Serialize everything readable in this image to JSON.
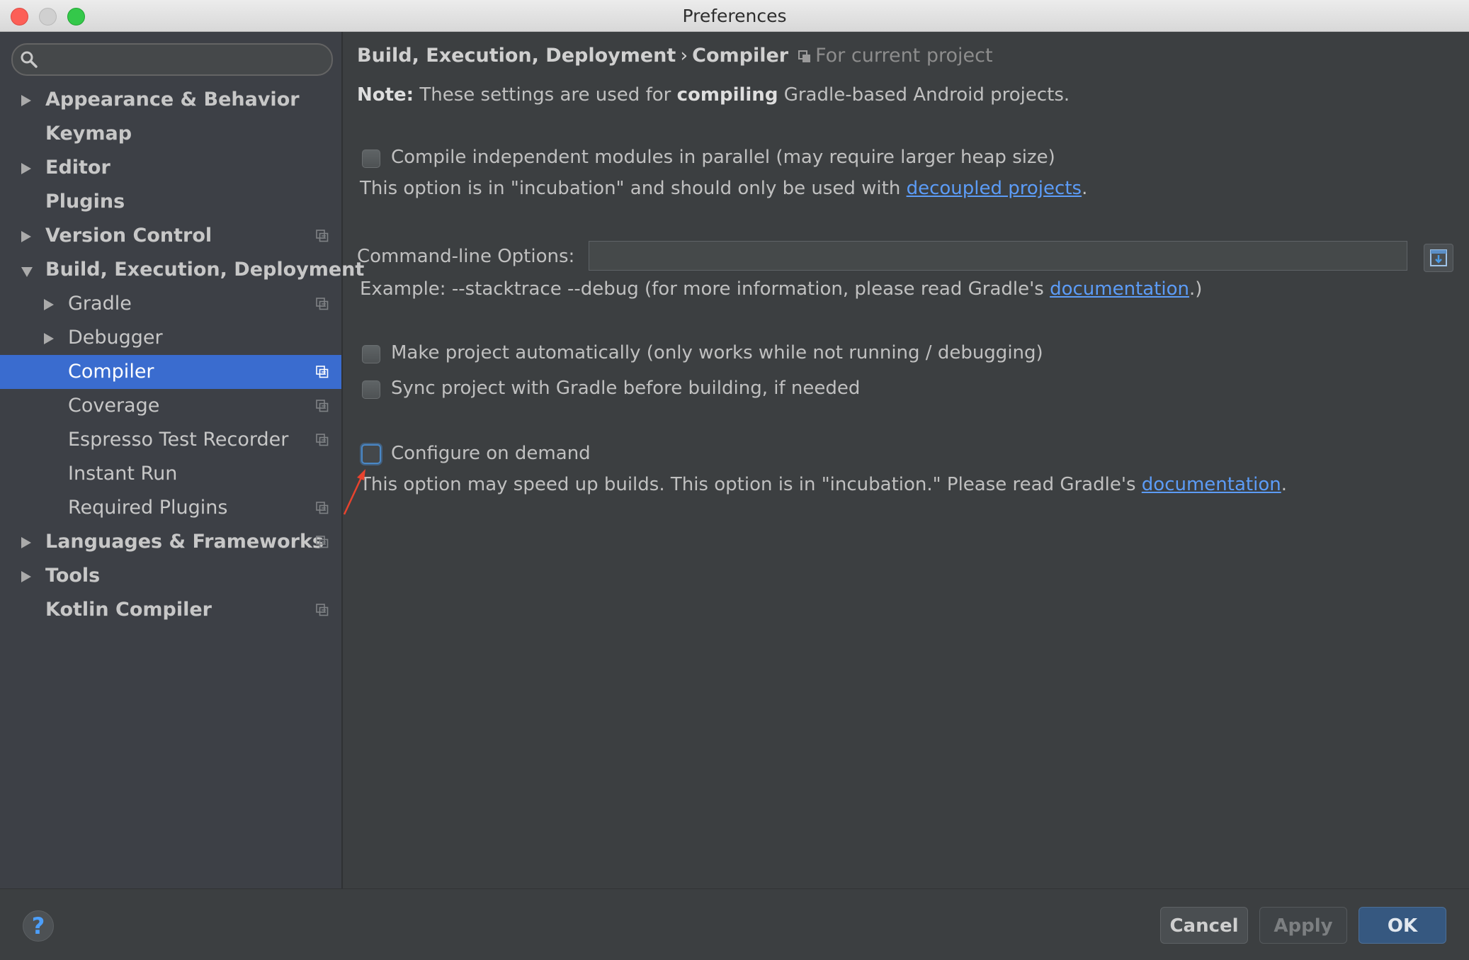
{
  "window": {
    "title": "Preferences"
  },
  "search": {
    "value": "",
    "placeholder": ""
  },
  "sidebar": {
    "items": [
      {
        "label": "Appearance & Behavior",
        "level": 0,
        "arrow": "right",
        "bold": true,
        "project_icon": false,
        "selected": false
      },
      {
        "label": "Keymap",
        "level": 0,
        "arrow": "none",
        "bold": true,
        "project_icon": false,
        "selected": false
      },
      {
        "label": "Editor",
        "level": 0,
        "arrow": "right",
        "bold": true,
        "project_icon": false,
        "selected": false
      },
      {
        "label": "Plugins",
        "level": 0,
        "arrow": "none",
        "bold": true,
        "project_icon": false,
        "selected": false
      },
      {
        "label": "Version Control",
        "level": 0,
        "arrow": "right",
        "bold": true,
        "project_icon": true,
        "selected": false
      },
      {
        "label": "Build, Execution, Deployment",
        "level": 0,
        "arrow": "down",
        "bold": true,
        "project_icon": false,
        "selected": false
      },
      {
        "label": "Gradle",
        "level": 1,
        "arrow": "right",
        "bold": false,
        "project_icon": true,
        "selected": false
      },
      {
        "label": "Debugger",
        "level": 1,
        "arrow": "right",
        "bold": false,
        "project_icon": false,
        "selected": false
      },
      {
        "label": "Compiler",
        "level": 1,
        "arrow": "none",
        "bold": false,
        "project_icon": true,
        "selected": true
      },
      {
        "label": "Coverage",
        "level": 1,
        "arrow": "none",
        "bold": false,
        "project_icon": true,
        "selected": false
      },
      {
        "label": "Espresso Test Recorder",
        "level": 1,
        "arrow": "none",
        "bold": false,
        "project_icon": true,
        "selected": false
      },
      {
        "label": "Instant Run",
        "level": 1,
        "arrow": "none",
        "bold": false,
        "project_icon": false,
        "selected": false
      },
      {
        "label": "Required Plugins",
        "level": 1,
        "arrow": "none",
        "bold": false,
        "project_icon": true,
        "selected": false
      },
      {
        "label": "Languages & Frameworks",
        "level": 0,
        "arrow": "right",
        "bold": true,
        "project_icon": true,
        "selected": false
      },
      {
        "label": "Tools",
        "level": 0,
        "arrow": "right",
        "bold": true,
        "project_icon": false,
        "selected": false
      },
      {
        "label": "Kotlin Compiler",
        "level": 0,
        "arrow": "none",
        "bold": true,
        "project_icon": true,
        "selected": false
      }
    ]
  },
  "main": {
    "breadcrumb": {
      "parent": "Build, Execution, Deployment",
      "separator": "›",
      "current": "Compiler",
      "scope": "For current project"
    },
    "note": {
      "prefix": "Note:",
      "pre": " These settings are used for ",
      "bold": "compiling",
      "post": " Gradle-based Android projects."
    },
    "parallel": {
      "label": "Compile independent modules in parallel (may require larger heap size)",
      "checked": false,
      "hint_pre": "This option is in \"incubation\" and should only be used with ",
      "hint_link": "decoupled projects",
      "hint_post": "."
    },
    "cmdline": {
      "label": "Command-line Options:",
      "value": "",
      "example_pre": "Example: --stacktrace --debug (for more information, please read Gradle's ",
      "example_link": "documentation",
      "example_post": ".)"
    },
    "make_auto": {
      "label": "Make project automatically (only works while not running / debugging)",
      "checked": false
    },
    "sync": {
      "label": "Sync project with Gradle before building, if needed",
      "checked": false
    },
    "configure": {
      "label": "Configure on demand",
      "checked": false,
      "hint_pre": "This option may speed up builds. This option is in \"incubation.\" Please read Gradle's ",
      "hint_link": "documentation",
      "hint_post": "."
    }
  },
  "buttons": {
    "help": "?",
    "cancel": "Cancel",
    "apply": "Apply",
    "ok": "OK"
  },
  "colors": {
    "selection": "#3a6ccf",
    "link": "#5c9cf7",
    "annotation_arrow": "#e8432e"
  }
}
